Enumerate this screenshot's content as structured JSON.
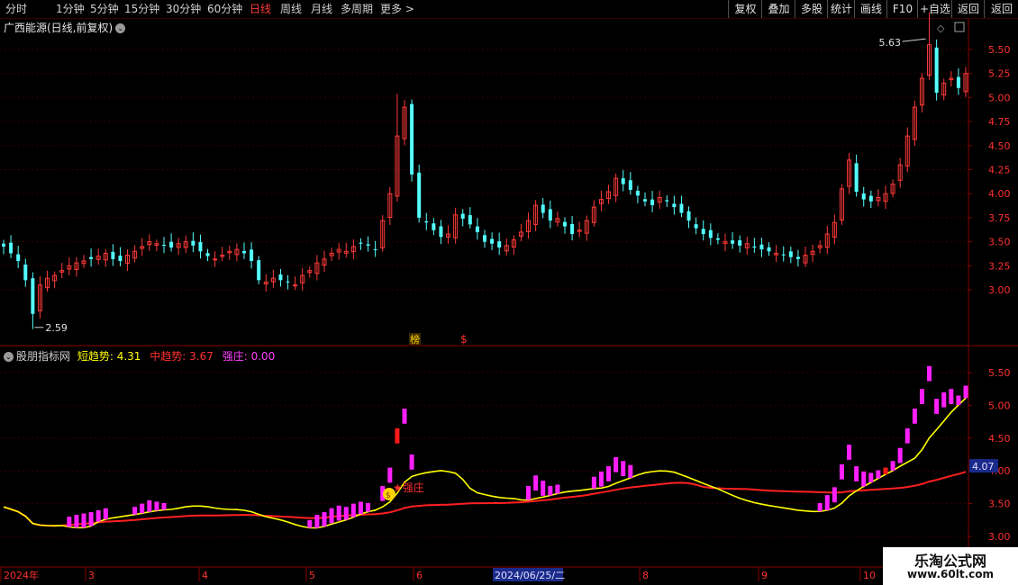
{
  "toolbar": {
    "periods": [
      "分时",
      "1分钟",
      "5分钟",
      "15分钟",
      "30分钟",
      "60分钟",
      "日线",
      "周线",
      "月线",
      "多周期",
      "更多 >"
    ],
    "active_period": "日线",
    "buttons": [
      "复权",
      "叠加",
      "多股",
      "统计",
      "画线",
      "F10",
      "+自选",
      "返回"
    ]
  },
  "main_chart": {
    "title": "广西能源(日线,前复权)",
    "price_ticks": [
      "5.50",
      "5.25",
      "5.00",
      "4.75",
      "4.50",
      "4.25",
      "4.00",
      "3.75",
      "3.50",
      "3.25",
      "3.00"
    ],
    "max_label": "5.63",
    "min_label": "2.59",
    "markers": [
      {
        "text": "榜",
        "color": "#ffd200"
      },
      {
        "text": "$",
        "color": "#ff3030"
      }
    ]
  },
  "indicator": {
    "name": "股朋指标网",
    "short_label": "短趋势:",
    "short_value": "4.31",
    "mid_label": "中趋势:",
    "mid_value": "3.67",
    "strong_label": "强庄:",
    "strong_value": "0.00",
    "ticks": [
      "5.50",
      "5.00",
      "4.50",
      "4.00",
      "3.50",
      "3.00"
    ],
    "current_value_tag": "4.07",
    "signal_label": "★强庄",
    "colors": {
      "short": "#ffff00",
      "mid": "#ff2020",
      "strong": "#ff20ff"
    }
  },
  "date_axis": {
    "labels": [
      "2024年",
      "3",
      "4",
      "5",
      "6",
      "2024/06/25/二",
      "8",
      "9",
      "10"
    ]
  },
  "watermark": {
    "line1": "乐淘公式网",
    "line2": "www.60lt.com"
  },
  "chart_data": {
    "type": "candlestick",
    "x_label": "date",
    "y_ticks": [
      3.0,
      3.25,
      3.5,
      3.75,
      4.0,
      4.25,
      4.5,
      4.75,
      5.0,
      5.25,
      5.5
    ],
    "ylim": [
      2.75,
      5.75
    ],
    "annotations": {
      "max": 5.63,
      "min": 2.59
    },
    "candles_close": [
      3.45,
      3.38,
      3.3,
      3.1,
      2.75,
      3.05,
      3.12,
      3.15,
      3.2,
      3.25,
      3.28,
      3.3,
      3.32,
      3.35,
      3.38,
      3.32,
      3.3,
      3.36,
      3.4,
      3.45,
      3.5,
      3.48,
      3.46,
      3.44,
      3.48,
      3.5,
      3.46,
      3.4,
      3.35,
      3.32,
      3.36,
      3.4,
      3.42,
      3.38,
      3.3,
      3.1,
      3.08,
      3.12,
      3.1,
      3.08,
      3.05,
      3.15,
      3.2,
      3.28,
      3.32,
      3.38,
      3.42,
      3.4,
      3.45,
      3.48,
      3.46,
      3.42,
      3.72,
      4.0,
      4.6,
      4.9,
      4.2,
      3.75,
      3.7,
      3.62,
      3.55,
      3.58,
      3.78,
      3.74,
      3.68,
      3.6,
      3.5,
      3.48,
      3.44,
      3.46,
      3.52,
      3.6,
      3.72,
      3.88,
      3.8,
      3.72,
      3.74,
      3.66,
      3.58,
      3.62,
      3.72,
      3.86,
      3.94,
      4.02,
      4.16,
      4.1,
      4.04,
      3.98,
      3.92,
      3.88,
      3.96,
      3.92,
      3.86,
      3.8,
      3.72,
      3.64,
      3.58,
      3.54,
      3.52,
      3.5,
      3.48,
      3.46,
      3.48,
      3.44,
      3.42,
      3.4,
      3.38,
      3.36,
      3.34,
      3.32,
      3.36,
      3.4,
      3.46,
      3.58,
      3.7,
      4.05,
      4.35,
      4.02,
      3.94,
      3.92,
      3.96,
      4.0,
      4.1,
      4.3,
      4.6,
      4.9,
      5.2,
      5.55,
      5.05,
      5.15,
      5.2,
      5.1,
      5.25
    ],
    "indicator": {
      "short_trend_last": 4.31,
      "mid_trend_last": 3.67,
      "strong_last": 0.0
    }
  }
}
